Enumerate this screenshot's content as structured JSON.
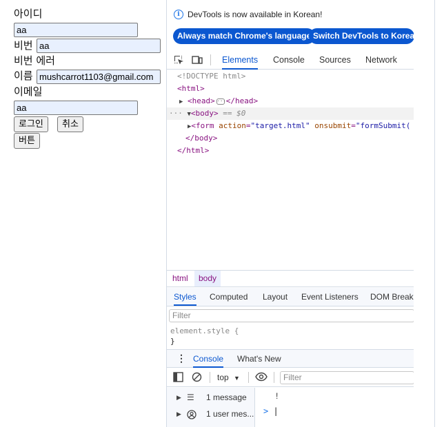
{
  "form": {
    "id_label": "아이디",
    "id_value": "aa",
    "pw_label": "비번",
    "pw_value": "aa",
    "pw_error": "비번 에러",
    "name_label": "이름",
    "name_value": "mushcarrot1103@gmail.com",
    "email_label": "이메일",
    "email_value": "aa",
    "login_button": "로그인",
    "cancel_button": "취소",
    "plain_button": "버튼"
  },
  "devtools": {
    "notice": "DevTools is now available in Korean!",
    "match_button": "Always match Chrome's language",
    "switch_button": "Switch DevTools to Korean",
    "tabs": [
      "Elements",
      "Console",
      "Sources",
      "Network"
    ],
    "active_tab": "Elements",
    "dom": {
      "doctype": "<!DOCTYPE html>",
      "html_open": "<html>",
      "head": "<head>",
      "head_close": "</head>",
      "body_open": "<body>",
      "body_marker": "== $0",
      "form_tag": "<form",
      "form_attr1": "action",
      "form_val1": "\"target.html\"",
      "form_attr2": "onsubmit",
      "form_val2": "\"formSubmit(",
      "body_close": "</body>",
      "html_close": "</html>"
    },
    "breadcrumbs": [
      "html",
      "body"
    ],
    "styles_tabs": [
      "Styles",
      "Computed",
      "Layout",
      "Event Listeners",
      "DOM Breakp"
    ],
    "styles_filter_placeholder": "Filter",
    "element_style": "element.style {",
    "element_style_close": "}",
    "drawer_tabs": [
      "Console",
      "What's New"
    ],
    "console_context": "top",
    "console_filter_placeholder": "Filter",
    "sidebar": [
      "1 message",
      "1 user mes..."
    ],
    "console_excl": "!",
    "console_prompt": ">"
  },
  "colors": {
    "accent": "#0b57d0",
    "autofill_bg": "#e8f0fe",
    "tag": "#881280",
    "attr": "#994500",
    "attr_value": "#1a1aa6"
  },
  "icons": [
    "info-icon",
    "inspect-icon",
    "device-toggle-icon",
    "more-icon",
    "kebab-icon",
    "sidebar-toggle-icon",
    "clear-console-icon",
    "dropdown-arrow-icon",
    "eye-icon",
    "list-icon",
    "user-icon"
  ]
}
